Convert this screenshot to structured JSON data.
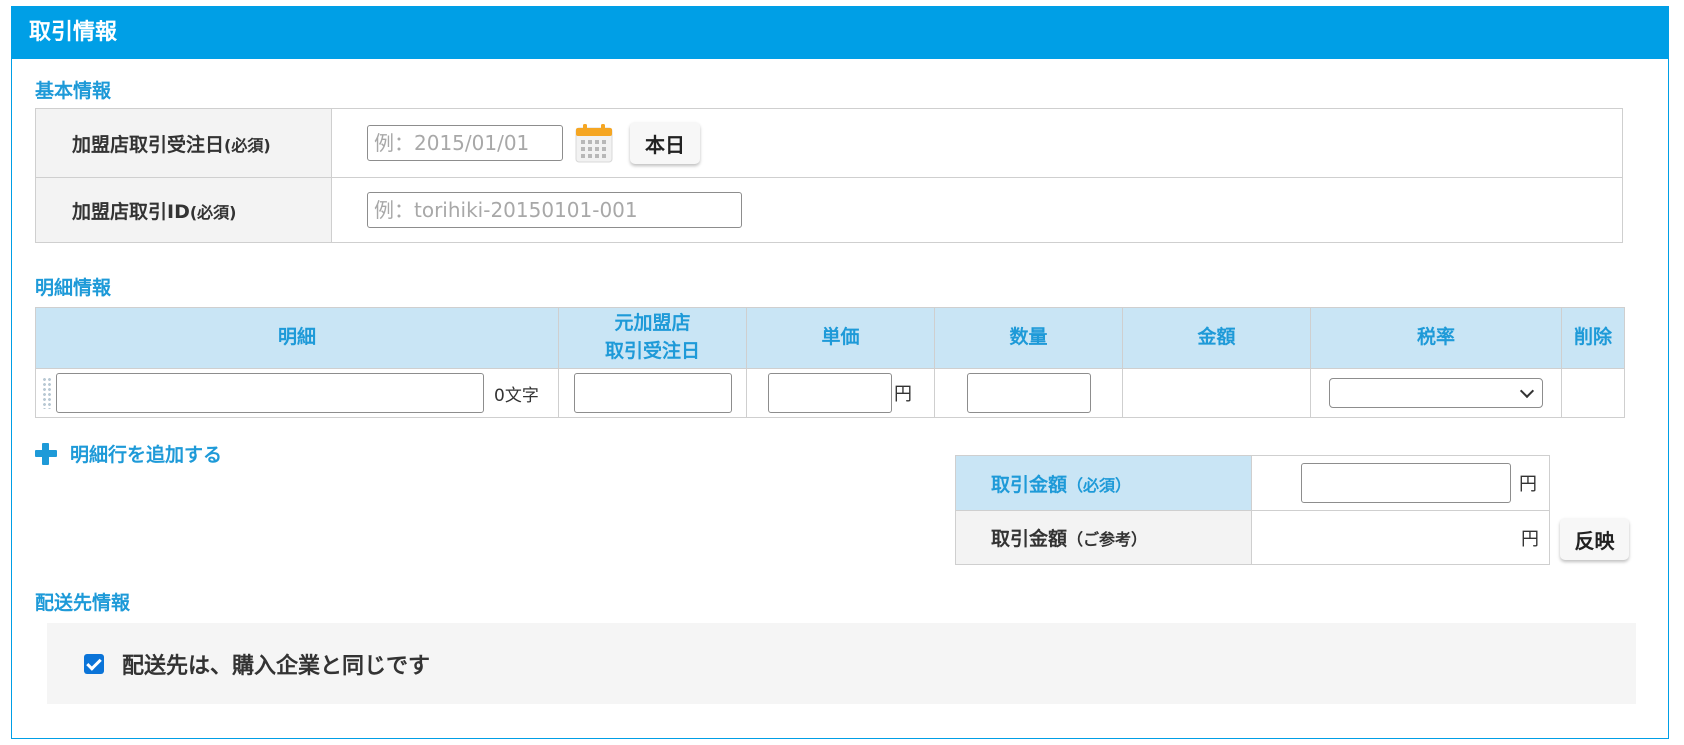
{
  "header": {
    "title": "取引情報"
  },
  "basic": {
    "section_title": "基本情報",
    "order_date": {
      "label": "加盟店取引受注日",
      "required": "(必須)",
      "placeholder": "例：2015/01/01",
      "today_button": "本日"
    },
    "transaction_id": {
      "label": "加盟店取引ID",
      "required": "(必須)",
      "placeholder": "例：torihiki-20150101-001"
    }
  },
  "details": {
    "section_title": "明細情報",
    "columns": {
      "item": "明細",
      "orig_date_line1": "元加盟店",
      "orig_date_line2": "取引受注日",
      "unit_price": "単価",
      "quantity": "数量",
      "amount": "金額",
      "tax_rate": "税率",
      "delete": "削除"
    },
    "row": {
      "item_value": "",
      "char_count": "0文字",
      "orig_date_value": "",
      "unit_price_value": "",
      "yen": "円",
      "quantity_value": "",
      "amount_value": "",
      "tax_rate_selected": ""
    },
    "add_row_label": "明細行を追加する"
  },
  "amount": {
    "required_label": "取引金額",
    "required_note": "（必須）",
    "required_value": "",
    "reference_label": "取引金額",
    "reference_note": "（ご参考）",
    "reference_value": "",
    "yen": "円",
    "reflect_button": "反映"
  },
  "delivery": {
    "section_title": "配送先情報",
    "same_as_buyer_label": "配送先は、購入企業と同じです",
    "same_as_buyer_checked": true
  },
  "colors": {
    "accent": "#009fe6",
    "section_text": "#1e9ad8",
    "header_cell_bg": "#c9e5f5",
    "checkbox": "#0b74d8"
  }
}
